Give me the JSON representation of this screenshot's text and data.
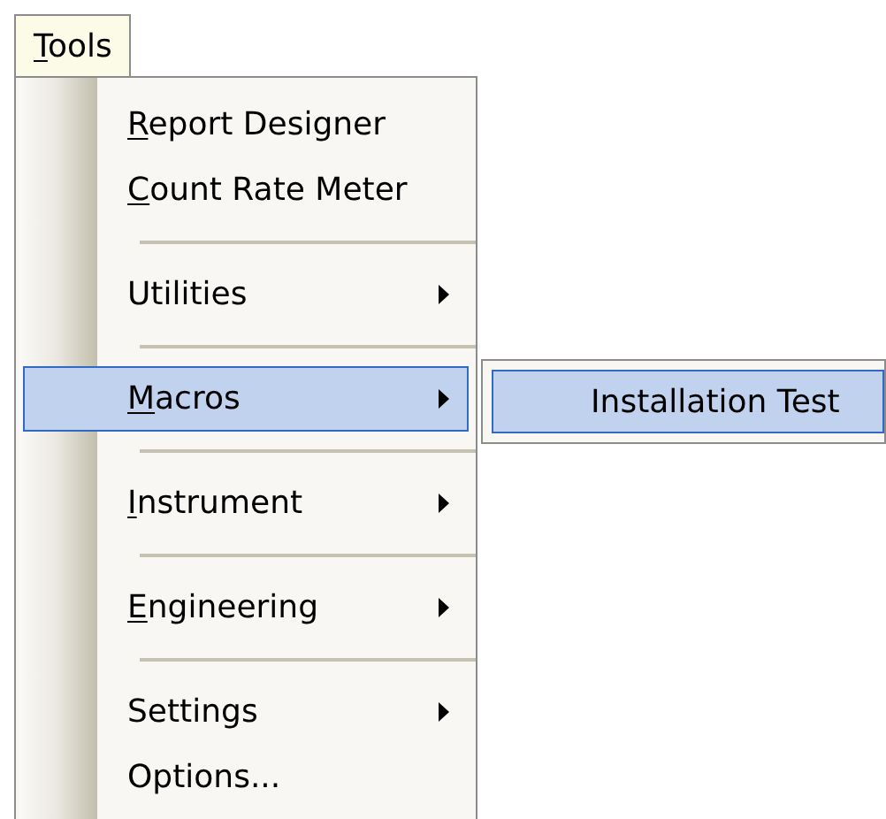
{
  "menu_bar": [
    {
      "access_key": "T",
      "label_after": "ools",
      "selected": true
    }
  ],
  "menu": {
    "items": [
      {
        "kind": "item",
        "access_key": "R",
        "label_after": "eport Designer",
        "has_submenu": false,
        "selected": false
      },
      {
        "kind": "item",
        "access_key": "C",
        "label_after": "ount Rate Meter",
        "has_submenu": false,
        "selected": false
      },
      {
        "kind": "separator"
      },
      {
        "kind": "item",
        "label": "Utilities",
        "has_submenu": true,
        "selected": false
      },
      {
        "kind": "separator"
      },
      {
        "kind": "item",
        "access_key": "M",
        "label_after": "acros",
        "has_submenu": true,
        "selected": true
      },
      {
        "kind": "separator"
      },
      {
        "kind": "item",
        "access_key": "I",
        "label_after": "nstrument",
        "has_submenu": true,
        "selected": false
      },
      {
        "kind": "separator"
      },
      {
        "kind": "item",
        "access_key": "E",
        "label_after": "ngineering",
        "has_submenu": true,
        "selected": false
      },
      {
        "kind": "separator"
      },
      {
        "kind": "item",
        "label": "Settings",
        "has_submenu": true,
        "selected": false
      },
      {
        "kind": "item",
        "label": "Options...",
        "has_submenu": false,
        "selected": false
      }
    ]
  },
  "submenu": {
    "items": [
      {
        "label": "Installation Test",
        "selected": true
      }
    ]
  }
}
